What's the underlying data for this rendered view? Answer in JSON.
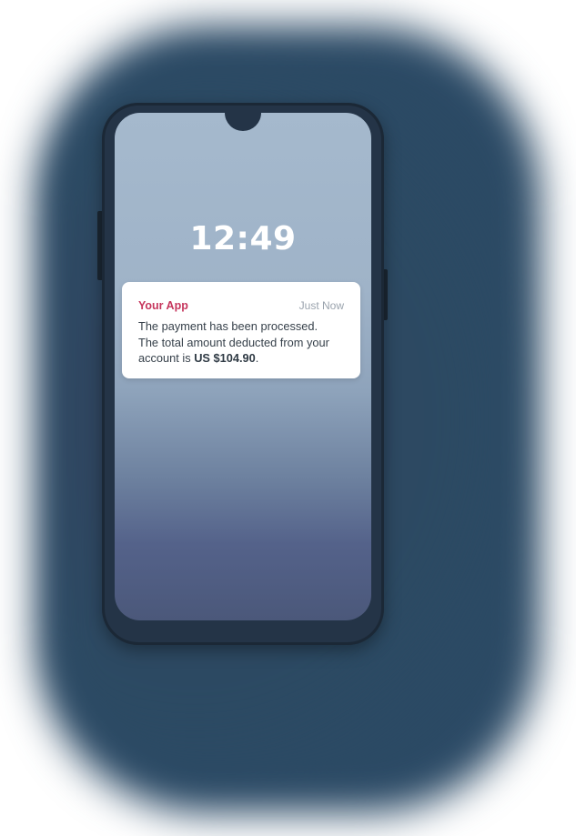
{
  "lock_screen": {
    "clock": "12:49"
  },
  "notification": {
    "app_name": "Your App",
    "time": "Just Now",
    "line1": "The payment has been processed.",
    "line2": "The total amount deducted from your",
    "line3_prefix": "account is ",
    "amount": "US $104.90",
    "line3_suffix": "."
  },
  "colors": {
    "app_name": "#c6365d",
    "background_glow": "#2b4a66",
    "phone_body": "#243447"
  }
}
